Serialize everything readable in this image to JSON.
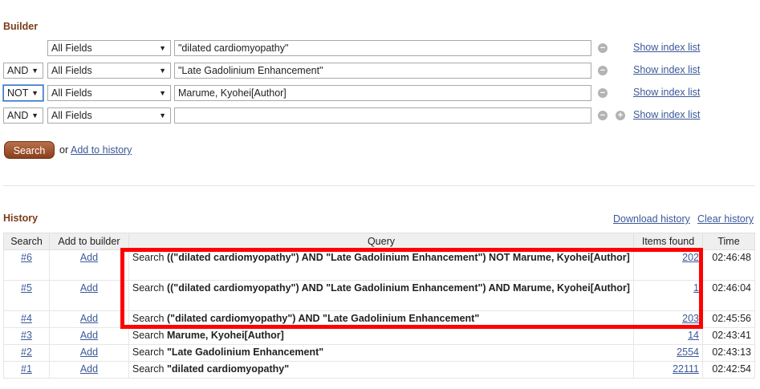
{
  "builder": {
    "title": "Builder",
    "rows": [
      {
        "operator": "",
        "field": "All Fields",
        "term": "\"dilated cardiomyopathy\"",
        "index_link": "Show index list"
      },
      {
        "operator": "AND",
        "field": "All Fields",
        "term": "\"Late Gadolinium Enhancement\"",
        "index_link": "Show index list"
      },
      {
        "operator": "NOT",
        "field": "All Fields",
        "term": "Marume, Kyohei[Author]",
        "index_link": "Show index list"
      },
      {
        "operator": "AND",
        "field": "All Fields",
        "term": "",
        "index_link": "Show index list"
      }
    ],
    "search_button": "Search",
    "or_text": "or",
    "add_to_history": "Add to history"
  },
  "history": {
    "title": "History",
    "download_link": "Download history",
    "clear_link": "Clear history",
    "columns": [
      "Search",
      "Add to builder",
      "Query",
      "Items found",
      "Time"
    ],
    "rows": [
      {
        "num": "#6",
        "add": "Add",
        "prefix": "Search",
        "query": "((\"dilated cardiomyopathy\") AND \"Late Gadolinium Enhancement\") NOT Marume, Kyohei[Author]",
        "items": "202",
        "time": "02:46:48"
      },
      {
        "num": "#5",
        "add": "Add",
        "prefix": "Search",
        "query": "((\"dilated cardiomyopathy\") AND \"Late Gadolinium Enhancement\") AND Marume, Kyohei[Author]",
        "items": "1",
        "time": "02:46:04"
      },
      {
        "num": "#4",
        "add": "Add",
        "prefix": "Search",
        "query": "(\"dilated cardiomyopathy\") AND \"Late Gadolinium Enhancement\"",
        "items": "203",
        "time": "02:45:56"
      },
      {
        "num": "#3",
        "add": "Add",
        "prefix": "Search",
        "query": "Marume, Kyohei[Author]",
        "items": "14",
        "time": "02:43:41"
      },
      {
        "num": "#2",
        "add": "Add",
        "prefix": "Search",
        "query": "\"Late Gadolinium Enhancement\"",
        "items": "2554",
        "time": "02:43:13"
      },
      {
        "num": "#1",
        "add": "Add",
        "prefix": "Search",
        "query": "\"dilated cardiomyopathy\"",
        "items": "22111",
        "time": "02:42:54"
      }
    ]
  },
  "colors": {
    "section_title": "#7c3b17",
    "link": "#3b5998",
    "highlight": "#ff0000",
    "button": "#8a3f1e"
  }
}
